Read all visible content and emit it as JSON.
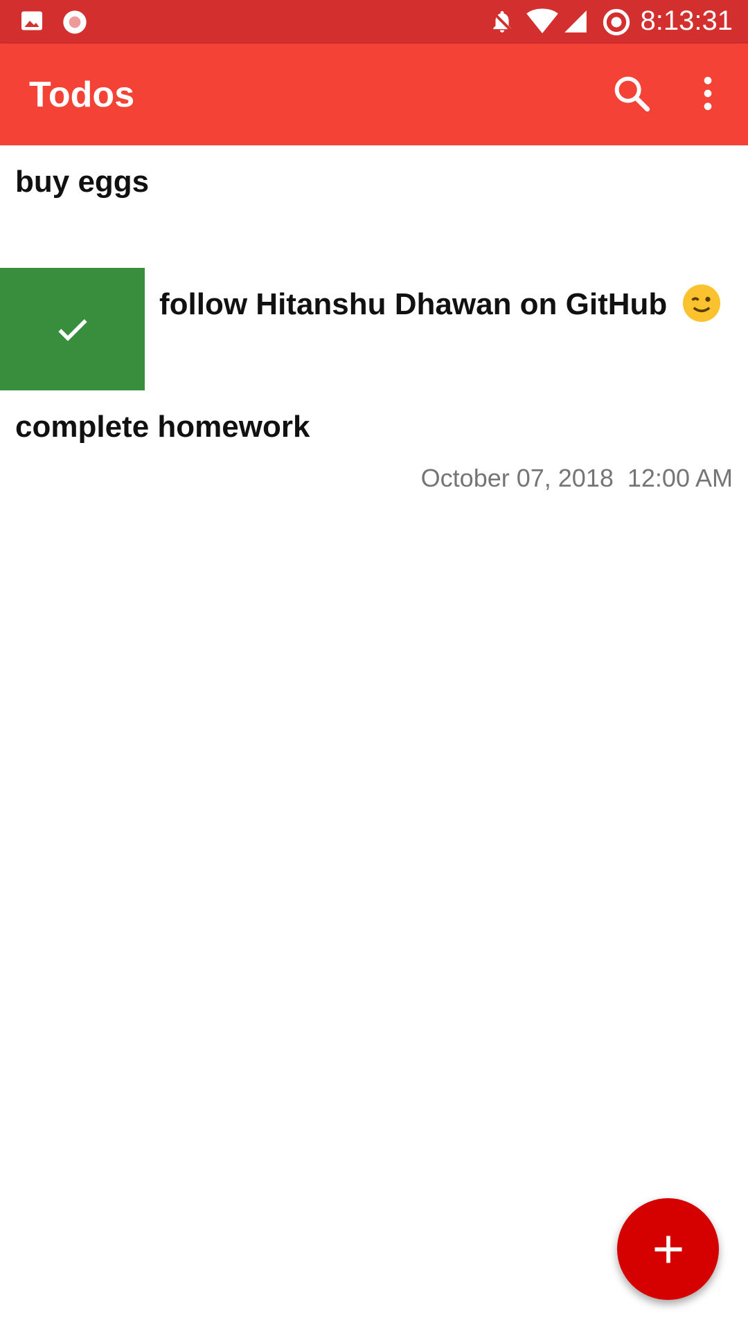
{
  "status_bar": {
    "time": "8:13:31",
    "icons": [
      "image-icon",
      "recording-icon",
      "notifications-off-icon",
      "wifi-icon",
      "signal-icon",
      "do-not-disturb-icon"
    ]
  },
  "app_bar": {
    "title": "Todos",
    "actions": [
      "search-icon",
      "more-vert-icon"
    ],
    "color": "#f44336"
  },
  "todos": [
    {
      "title": "buy eggs",
      "done": false
    },
    {
      "title": "follow Hitanshu Dhawan on GitHub",
      "emoji": "winking-face-icon",
      "done": true
    },
    {
      "title": "complete homework",
      "date": "October 07, 2018",
      "time": "12:00 AM",
      "done": false
    }
  ],
  "fab": {
    "icon": "plus-icon",
    "color": "#d50000"
  },
  "colors": {
    "status_bar": "#d32f2f",
    "done_badge": "#388e3c"
  }
}
